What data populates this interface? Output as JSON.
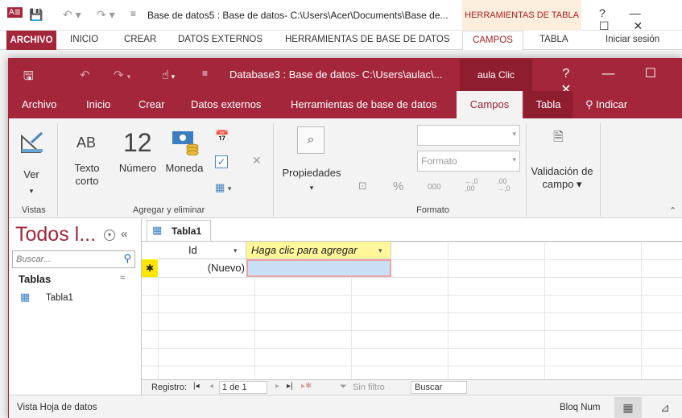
{
  "colors": {
    "brand": "#a4263a",
    "selected_cell": "#c9dff5",
    "new_field_header": "#fff799",
    "new_row_marker": "#ffe600"
  },
  "background_window": {
    "title": "Base de datos5 : Base de datos- C:\\Users\\Acer\\Documents\\Base de...",
    "contextual_group": "HERRAMIENTAS DE TABLA",
    "help": "?",
    "tabs": [
      "ARCHIVO",
      "INICIO",
      "CREAR",
      "DATOS EXTERNOS",
      "HERRAMIENTAS DE BASE DE DATOS",
      "CAMPOS",
      "TABLA"
    ],
    "sign_in": "Iniciar sesión"
  },
  "window": {
    "title": "Database3 : Base de datos- C:\\Users\\aulac\\...",
    "account": "aula Clic",
    "help": "?",
    "tabs": [
      "Archivo",
      "Inicio",
      "Crear",
      "Datos externos",
      "Herramientas de base de datos",
      "Campos",
      "Tabla"
    ],
    "tell_me": "Indicar",
    "active_tab": "Campos"
  },
  "ribbon": {
    "views": {
      "button": "Ver",
      "group": "Vistas"
    },
    "add_delete": {
      "group": "Agregar y eliminar",
      "short_text_icon": "AB",
      "short_text": [
        "Texto",
        "corto"
      ],
      "number_icon": "12",
      "number": "Número",
      "currency": "Moneda"
    },
    "properties": {
      "label": "Propiedades"
    },
    "format": {
      "group": "Formato",
      "format_combo": "Formato",
      "percent": "%",
      "thousands": "000",
      "dec_inc": "←,0\n,00",
      "dec_dec": ",00\n→,0"
    },
    "validation": {
      "label": [
        "Validación de",
        "campo ▾"
      ]
    }
  },
  "nav_pane": {
    "title": "Todos l...",
    "search_placeholder": "Buscar...",
    "section": "Tablas",
    "items": [
      "Tabla1"
    ]
  },
  "datasheet": {
    "tab": "Tabla1",
    "columns": [
      "Id",
      "Haga clic para agregar"
    ],
    "new_row_id": "(Nuevo)",
    "new_row_marker": "✱",
    "record_nav": {
      "label": "Registro:",
      "position": "1 de 1",
      "filter": "Sin filtro",
      "search": "Buscar"
    }
  },
  "status_bar": {
    "view": "Vista Hoja de datos",
    "numlock": "Bloq Num"
  }
}
